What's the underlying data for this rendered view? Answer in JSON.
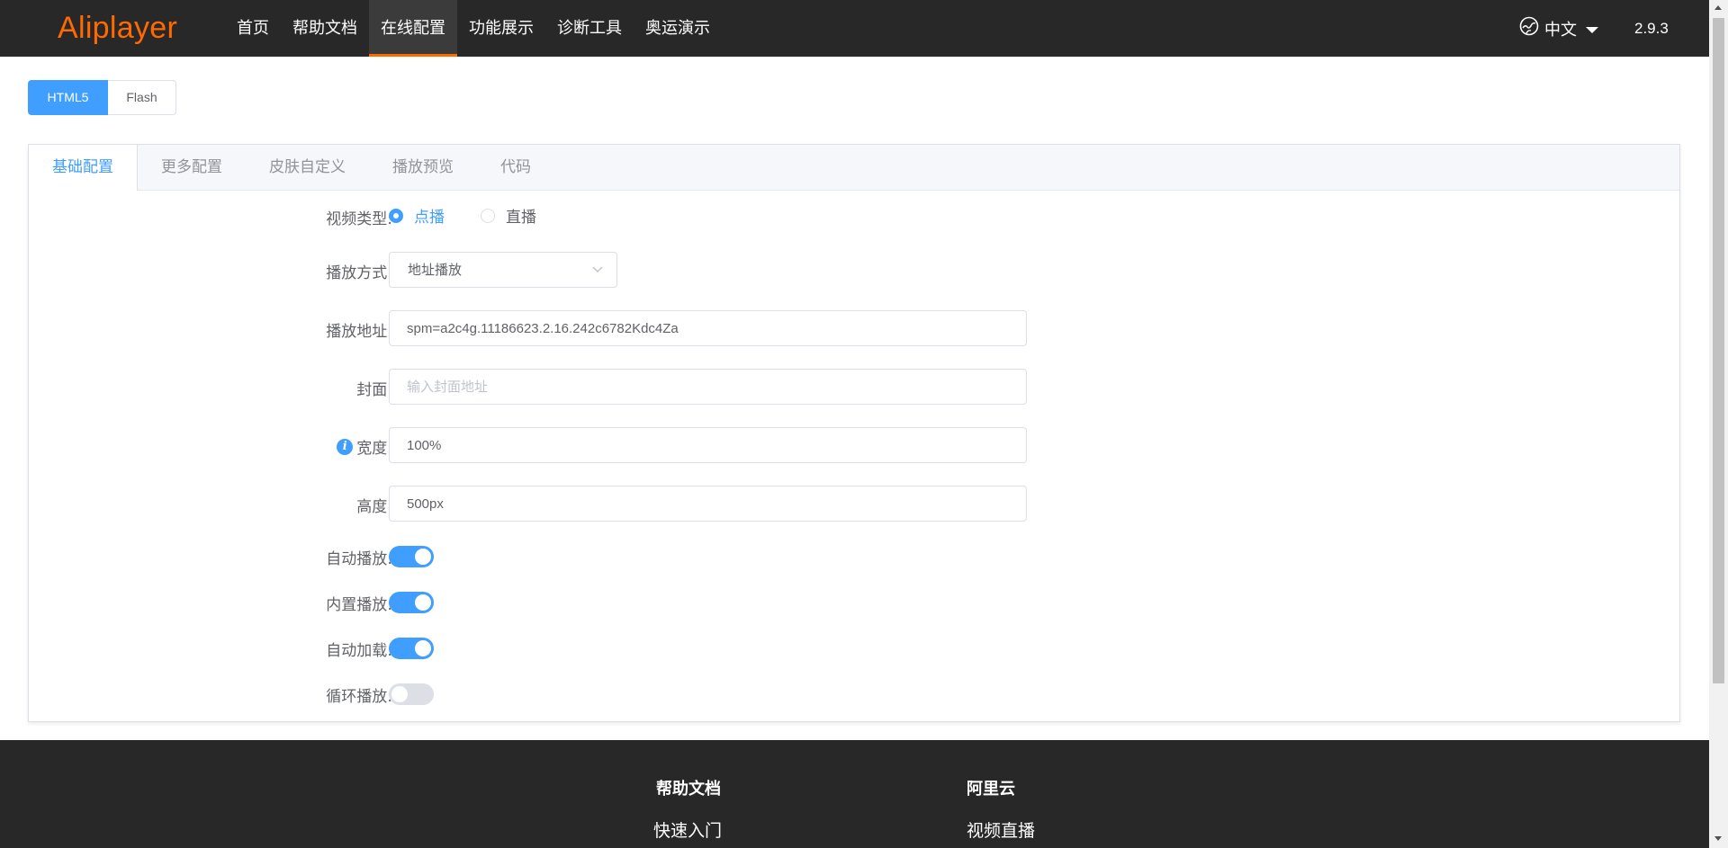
{
  "header": {
    "logo": "Aliplayer",
    "nav": [
      {
        "label": "首页"
      },
      {
        "label": "帮助文档"
      },
      {
        "label": "在线配置",
        "active": true
      },
      {
        "label": "功能展示"
      },
      {
        "label": "诊断工具"
      },
      {
        "label": "奥运演示"
      }
    ],
    "language": "中文",
    "version": "2.9.3"
  },
  "engine_switch": {
    "options": [
      "HTML5",
      "Flash"
    ],
    "selected": "HTML5"
  },
  "tabs": [
    {
      "label": "基础配置",
      "active": true
    },
    {
      "label": "更多配置"
    },
    {
      "label": "皮肤自定义"
    },
    {
      "label": "播放预览"
    },
    {
      "label": "代码"
    }
  ],
  "form": {
    "video_type": {
      "label": "视频类型:",
      "options": [
        "点播",
        "直播"
      ],
      "selected": "点播"
    },
    "play_mode": {
      "label": "播放方式:",
      "value": "地址播放"
    },
    "source": {
      "label": "播放地址:",
      "value": "spm=a2c4g.11186623.2.16.242c6782Kdc4Za"
    },
    "cover": {
      "label": "封面:",
      "placeholder": "输入封面地址",
      "value": ""
    },
    "width": {
      "label": "宽度:",
      "value": "100%"
    },
    "height": {
      "label": "高度:",
      "value": "500px"
    },
    "autoplay": {
      "label": "自动播放:",
      "on": true
    },
    "inline_play": {
      "label": "内置播放:",
      "on": true
    },
    "preload": {
      "label": "自动加载:",
      "on": true
    },
    "loop": {
      "label": "循环播放:",
      "on": false
    }
  },
  "footer": {
    "columns": [
      {
        "title": "帮助文档",
        "link": "快速入门"
      },
      {
        "title": "阿里云",
        "link": "视频直播"
      }
    ]
  },
  "colors": {
    "brand": "#ff6a00",
    "primary": "#409eff",
    "topbar_bg": "#282828"
  }
}
